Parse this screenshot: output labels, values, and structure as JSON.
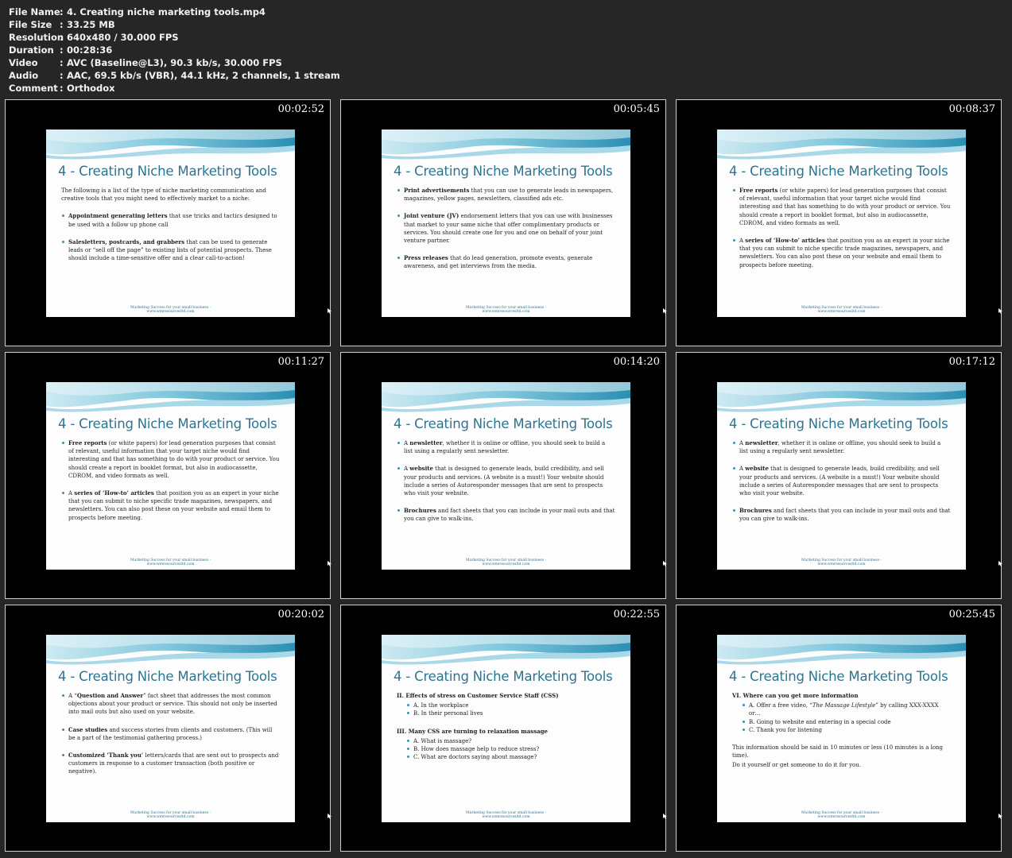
{
  "meta": [
    {
      "key": "File Name",
      "value": "4. Creating niche marketing tools.mp4"
    },
    {
      "key": "File Size",
      "value": "33.25 MB"
    },
    {
      "key": "Resolution",
      "value": "640x480 / 30.000 FPS"
    },
    {
      "key": "Duration",
      "value": "00:28:36"
    },
    {
      "key": "Video",
      "value": "AVC (Baseline@L3), 90.3 kb/s, 30.000 FPS"
    },
    {
      "key": "Audio",
      "value": "AAC, 69.5 kb/s (VBR), 44.1 kHz, 2 channels, 1 stream"
    },
    {
      "key": "Comment",
      "value": "Orthodox"
    }
  ],
  "meta_separator": ":",
  "slide_title": "4 - Creating Niche Marketing Tools",
  "footer_line1": "Marketing Success for your small business -",
  "footer_line2": "www.wmresourcesltd.com",
  "colors": {
    "title": "#2c7591",
    "wave_light": "#cdeaf2",
    "wave_dark": "#2a8fb3",
    "background": "#262626"
  },
  "thumbnails": [
    {
      "time": "00:02:52",
      "blocks": [
        {
          "t": "p",
          "parts": [
            {
              "t": "The following is a list of the type of niche marketing communication and creative tools that you might need to effectively market to a niche:"
            }
          ]
        },
        {
          "t": "bul",
          "parts": [
            {
              "b": "Appointment generating letters"
            },
            {
              "t": " that use tricks and tactics designed to be used with a follow up phone call"
            }
          ]
        },
        {
          "t": "bul",
          "parts": [
            {
              "b": "Salesletters, postcards, and grabbers"
            },
            {
              "t": " that can be used to generate leads or “sell off the page” to existing lists of potential prospects. These should include a time-sensitive offer and a clear call-to-action!"
            }
          ]
        }
      ]
    },
    {
      "time": "00:05:45",
      "blocks": [
        {
          "t": "bul",
          "parts": [
            {
              "b": "Print advertisements"
            },
            {
              "t": " that you can use to generate leads in newspapers, magazines, yellow pages, newsletters, classified ads etc."
            }
          ]
        },
        {
          "t": "bul",
          "parts": [
            {
              "b": "Joint venture (JV)"
            },
            {
              "t": " endorsement letters that you can use with businesses that market to your same niche that offer complimentary products or services. You should create one for you and one on behalf of your joint venture partner."
            }
          ]
        },
        {
          "t": "bul",
          "parts": [
            {
              "b": "Press releases"
            },
            {
              "t": " that do lead generation, promote events, generate awareness, and get interviews from the media."
            }
          ]
        }
      ]
    },
    {
      "time": "00:08:37",
      "blocks": [
        {
          "t": "bul",
          "parts": [
            {
              "b": "Free reports"
            },
            {
              "t": " (or white papers) for lead generation purposes that consist of relevant, useful information that your target niche would find interesting and that has something to do with your product or service. You should create a report in booklet format, but also in audiocassette, CDROM, and video formats as well."
            }
          ]
        },
        {
          "t": "bul",
          "parts": [
            {
              "t": "A "
            },
            {
              "b": "series of ‘How-to’ articles"
            },
            {
              "t": " that position you as an expert in your niche that you can submit to niche specific trade magazines, newspapers, and newsletters. You can also post these on your website and email them to prospects before meeting."
            }
          ]
        }
      ]
    },
    {
      "time": "00:11:27",
      "blocks": [
        {
          "t": "bul",
          "parts": [
            {
              "b": "Free reports"
            },
            {
              "t": " (or white papers) for lead generation purposes that consist of relevant, useful information that your target niche would find interesting and that has something to do with your product or service. You should create a report in booklet format, but also in audiocassette, CDROM, and video formats as well."
            }
          ]
        },
        {
          "t": "bul",
          "parts": [
            {
              "t": "A "
            },
            {
              "b": "series of ‘How-to’ articles"
            },
            {
              "t": " that position you as an expert in your niche that you can submit to niche specific trade magazines, newspapers, and newsletters. You can also post these on your website and email them to prospects before meeting."
            }
          ]
        }
      ]
    },
    {
      "time": "00:14:20",
      "blocks": [
        {
          "t": "bul",
          "parts": [
            {
              "t": "A "
            },
            {
              "b": "newsletter"
            },
            {
              "t": ", whether it is online or offline, you should seek to build a list using a regularly sent newsletter."
            }
          ]
        },
        {
          "t": "bul",
          "parts": [
            {
              "t": "A "
            },
            {
              "b": "website"
            },
            {
              "t": " that is designed to generate leads, build credibility, and sell your products and services. (A website is a must!) Your website should include a series of Autoresponder messages that are sent to prospects who visit your website."
            }
          ]
        },
        {
          "t": "bul",
          "parts": [
            {
              "b": "Brochures"
            },
            {
              "t": " and fact sheets that you can include in your mail outs and that you can give to walk-ins."
            }
          ]
        }
      ]
    },
    {
      "time": "00:17:12",
      "blocks": [
        {
          "t": "bul",
          "parts": [
            {
              "t": "A "
            },
            {
              "b": "newsletter"
            },
            {
              "t": ", whether it is online or offline, you should seek to build a list using a regularly sent newsletter."
            }
          ]
        },
        {
          "t": "bul",
          "parts": [
            {
              "t": "A "
            },
            {
              "b": "website"
            },
            {
              "t": " that is designed to generate leads, build credibility, and sell your products and services. (A website is a must!) Your website should include a series of Autoresponder messages that are sent to prospects who visit your website."
            }
          ]
        },
        {
          "t": "bul",
          "parts": [
            {
              "b": "Brochures"
            },
            {
              "t": " and fact sheets that you can include in your mail outs and that you can give to walk-ins."
            }
          ]
        }
      ]
    },
    {
      "time": "00:20:02",
      "blocks": [
        {
          "t": "bul",
          "parts": [
            {
              "t": "A “"
            },
            {
              "b": "Question and Answer"
            },
            {
              "t": "” fact sheet that addresses the most common objections about your product or service. This should not only be inserted into mail outs but also used on your website."
            }
          ]
        },
        {
          "t": "bul",
          "parts": [
            {
              "b": "Case studies"
            },
            {
              "t": " and success stories from clients and customers. (This will be a part of the testimonial gathering process.)"
            }
          ]
        },
        {
          "t": "bul",
          "parts": [
            {
              "b": "Customized ‘Thank you’"
            },
            {
              "t": " letters/cards that are sent out to prospects and customers in response to a customer transaction (both positive or negative)."
            }
          ]
        }
      ]
    },
    {
      "time": "00:22:55",
      "blocks": [
        {
          "t": "plain",
          "parts": [
            {
              "b": "II. Effects of stress on Customer Service Staff (CSS)"
            }
          ]
        },
        {
          "t": "sub",
          "parts": [
            {
              "t": "A. In the workplace"
            }
          ]
        },
        {
          "t": "sub",
          "parts": [
            {
              "t": "B. In their personal lives"
            }
          ]
        },
        {
          "t": "gap",
          "parts": []
        },
        {
          "t": "plain",
          "parts": [
            {
              "b": "III. Many CSS are turning to relaxation massage"
            }
          ]
        },
        {
          "t": "sub",
          "parts": [
            {
              "t": "A. What is massage?"
            }
          ]
        },
        {
          "t": "sub",
          "parts": [
            {
              "t": "B. How does massage help to reduce stress?"
            }
          ]
        },
        {
          "t": "sub",
          "parts": [
            {
              "t": "C. What are doctors saying about massage?"
            }
          ]
        }
      ]
    },
    {
      "time": "00:25:45",
      "blocks": [
        {
          "t": "plain",
          "parts": [
            {
              "b": "VI. Where can you get more information"
            }
          ]
        },
        {
          "t": "sub",
          "parts": [
            {
              "t": "A. Offer a free video, "
            },
            {
              "i": "“The Massage Lifestyle”"
            },
            {
              "t": " by calling XXX-XXXX or…"
            }
          ]
        },
        {
          "t": "sub",
          "parts": [
            {
              "t": "B. Going to website and entering in a special code"
            }
          ]
        },
        {
          "t": "sub",
          "parts": [
            {
              "t": "C. Thank you for listening"
            }
          ]
        },
        {
          "t": "gap",
          "parts": []
        },
        {
          "t": "plain",
          "parts": [
            {
              "t": "This information should be said in 10 minutes or less (10 minutes is a long time)."
            }
          ]
        },
        {
          "t": "plain",
          "parts": [
            {
              "t": "Do it yourself or get someone to do it for you."
            }
          ]
        }
      ]
    }
  ]
}
